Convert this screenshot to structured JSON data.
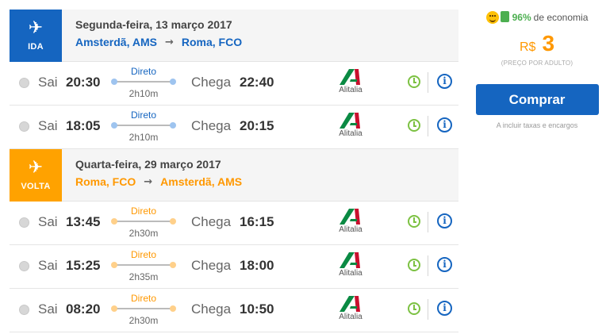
{
  "legs": [
    {
      "badge": "IDA",
      "date": "Segunda-feira, 13 março 2017",
      "from": "Amsterdã, AMS",
      "to": "Roma, FCO",
      "flights": [
        {
          "sai": "Sai",
          "dep": "20:30",
          "stops": "Direto",
          "duration": "2h10m",
          "chega": "Chega",
          "arr": "22:40",
          "airline": "Alitalia"
        },
        {
          "sai": "Sai",
          "dep": "18:05",
          "stops": "Direto",
          "duration": "2h10m",
          "chega": "Chega",
          "arr": "20:15",
          "airline": "Alitalia"
        }
      ]
    },
    {
      "badge": "VOLTA",
      "date": "Quarta-feira, 29 março 2017",
      "from": "Roma, FCO",
      "to": "Amsterdã, AMS",
      "flights": [
        {
          "sai": "Sai",
          "dep": "13:45",
          "stops": "Direto",
          "duration": "2h30m",
          "chega": "Chega",
          "arr": "16:15",
          "airline": "Alitalia"
        },
        {
          "sai": "Sai",
          "dep": "15:25",
          "stops": "Direto",
          "duration": "2h35m",
          "chega": "Chega",
          "arr": "18:00",
          "airline": "Alitalia"
        },
        {
          "sai": "Sai",
          "dep": "08:20",
          "stops": "Direto",
          "duration": "2h30m",
          "chega": "Chega",
          "arr": "10:50",
          "airline": "Alitalia"
        }
      ]
    }
  ],
  "side": {
    "economy_pct": "96%",
    "economy_label": "de economia",
    "currency": "R$",
    "price": "3",
    "per_adult": "(PREÇO POR ADULTO)",
    "buy_label": "Comprar",
    "taxes": "A incluir taxas e encargos"
  },
  "icons": {
    "plane": "airplane-icon",
    "clock": "clock-icon",
    "info": "info-icon",
    "airline_logo": "alitalia-logo-icon"
  },
  "colors": {
    "ida": "#1565c0",
    "volta": "#ffa200",
    "price": "#ff9800",
    "economy": "#4caf50"
  }
}
